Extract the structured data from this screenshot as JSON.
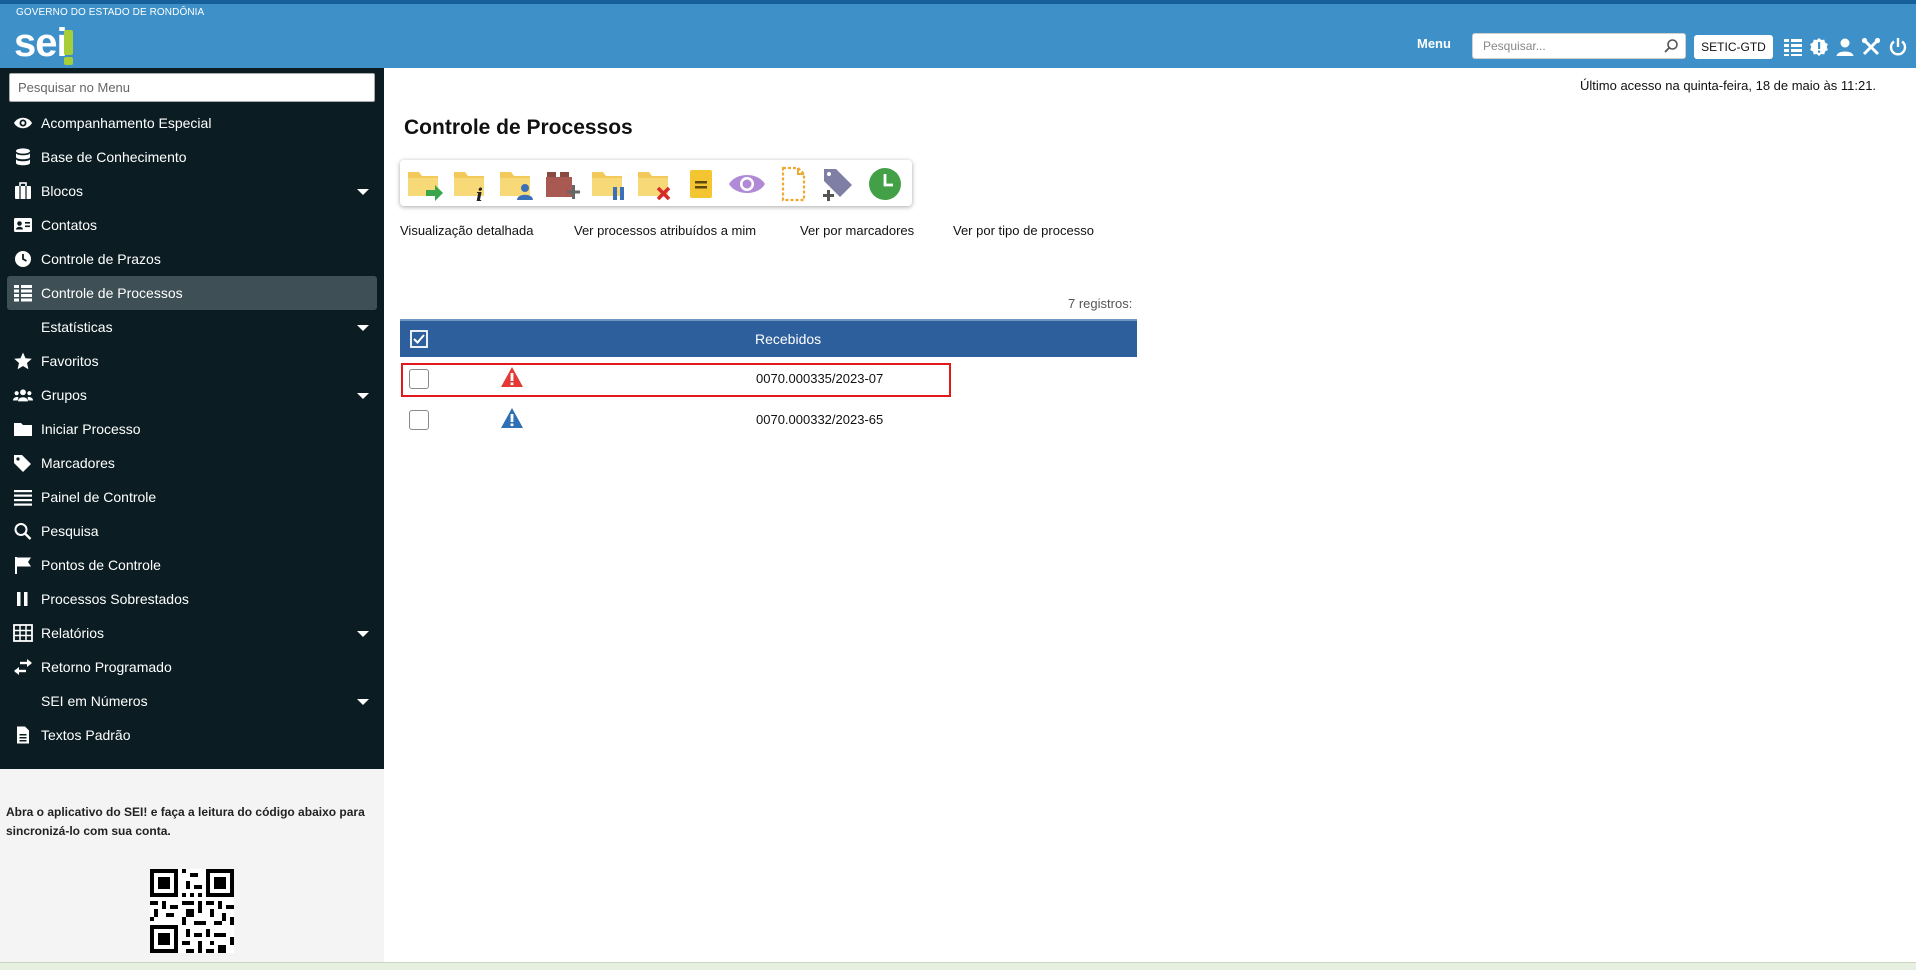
{
  "header": {
    "gov_title": "GOVERNO DO ESTADO DE RONDÔNIA",
    "logo_text": "sei",
    "menu_label": "Menu",
    "search_placeholder": "Pesquisar...",
    "unit": "SETIC-GTD",
    "icons": [
      "grid-icon",
      "alert-badge-icon",
      "user-icon",
      "tools-icon",
      "power-icon"
    ]
  },
  "sidebar": {
    "search_placeholder": "Pesquisar no Menu",
    "items": [
      {
        "label": "Acompanhamento Especial",
        "icon": "eye-icon",
        "caret": false
      },
      {
        "label": "Base de Conhecimento",
        "icon": "database-icon",
        "caret": false
      },
      {
        "label": "Blocos",
        "icon": "briefcase-icon",
        "caret": true
      },
      {
        "label": "Contatos",
        "icon": "contact-card-icon",
        "caret": false
      },
      {
        "label": "Controle de Prazos",
        "icon": "clock-icon",
        "caret": false
      },
      {
        "label": "Controle de Processos",
        "icon": "list-icon",
        "caret": false,
        "active": true
      },
      {
        "label": "Estatísticas",
        "icon": "",
        "caret": true
      },
      {
        "label": "Favoritos",
        "icon": "star-icon",
        "caret": false
      },
      {
        "label": "Grupos",
        "icon": "users-icon",
        "caret": true
      },
      {
        "label": "Iniciar Processo",
        "icon": "folder-icon",
        "caret": false
      },
      {
        "label": "Marcadores",
        "icon": "tag-icon",
        "caret": false
      },
      {
        "label": "Painel de Controle",
        "icon": "bars-icon",
        "caret": false
      },
      {
        "label": "Pesquisa",
        "icon": "search-icon",
        "caret": false
      },
      {
        "label": "Pontos de Controle",
        "icon": "flag-icon",
        "caret": false
      },
      {
        "label": "Processos Sobrestados",
        "icon": "pause-icon",
        "caret": false
      },
      {
        "label": "Relatórios",
        "icon": "table-icon",
        "caret": true
      },
      {
        "label": "Retorno Programado",
        "icon": "arrows-icon",
        "caret": false
      },
      {
        "label": "SEI em Números",
        "icon": "",
        "caret": true
      },
      {
        "label": "Textos Padrão",
        "icon": "document-icon",
        "caret": false
      }
    ],
    "qr_text": "Abra o aplicativo do SEI! e faça a leitura do código abaixo para sincronizá-lo com sua conta."
  },
  "main": {
    "last_access": "Último acesso na quinta-feira, 18 de maio às 11:21.",
    "title": "Controle de Processos",
    "toolbar_icons": [
      "send-process-icon",
      "process-info-icon",
      "assign-process-icon",
      "add-to-block-icon",
      "suspend-process-icon",
      "conclude-process-icon",
      "annotation-icon",
      "follow-up-icon",
      "new-document-icon",
      "add-marker-icon",
      "schedule-return-icon"
    ],
    "view_links": [
      "Visualização detalhada",
      "Ver processos atribuídos a mim",
      "Ver por marcadores",
      "Ver por tipo de processo"
    ],
    "records": "7 registros:",
    "table": {
      "header": "Recebidos",
      "rows": [
        {
          "process": "0070.000335/2023-07",
          "warning": "red"
        },
        {
          "process": "0070.000332/2023-65",
          "warning": "blue"
        }
      ]
    }
  },
  "colors": {
    "header_bg": "#3d90c8",
    "sidebar_bg": "#0b1d22",
    "table_header_bg": "#2d5f9c",
    "highlight": "#e2191c",
    "logo_accent": "#a6ce39"
  }
}
